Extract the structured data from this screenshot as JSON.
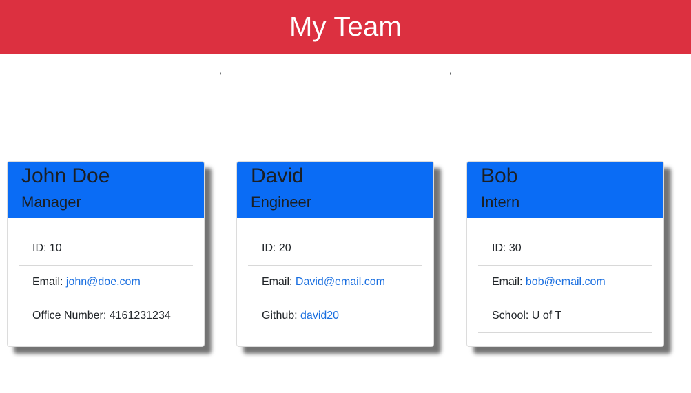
{
  "header": {
    "title": "My Team"
  },
  "stray_marks": [
    ",",
    ","
  ],
  "cards": [
    {
      "name": "John Doe",
      "role": "Manager",
      "id_label": "ID: ",
      "id_value": "10",
      "email_label": "Email: ",
      "email": "john@doe.com",
      "extra_label": "Office Number: ",
      "extra_value": "4161231234"
    },
    {
      "name": "David",
      "role": "Engineer",
      "id_label": "ID: ",
      "id_value": "20",
      "email_label": "Email: ",
      "email": "David@email.com",
      "extra_label": "Github: ",
      "extra_value": "david20"
    },
    {
      "name": "Bob",
      "role": "Intern",
      "id_label": "ID: ",
      "id_value": "30",
      "email_label": "Email: ",
      "email": "bob@email.com",
      "extra_label": "School: ",
      "extra_value": "U of T"
    }
  ],
  "colors": {
    "header_bg": "#dc3040",
    "card_head_bg": "#0a6cf5",
    "link": "#1a6fe0"
  }
}
